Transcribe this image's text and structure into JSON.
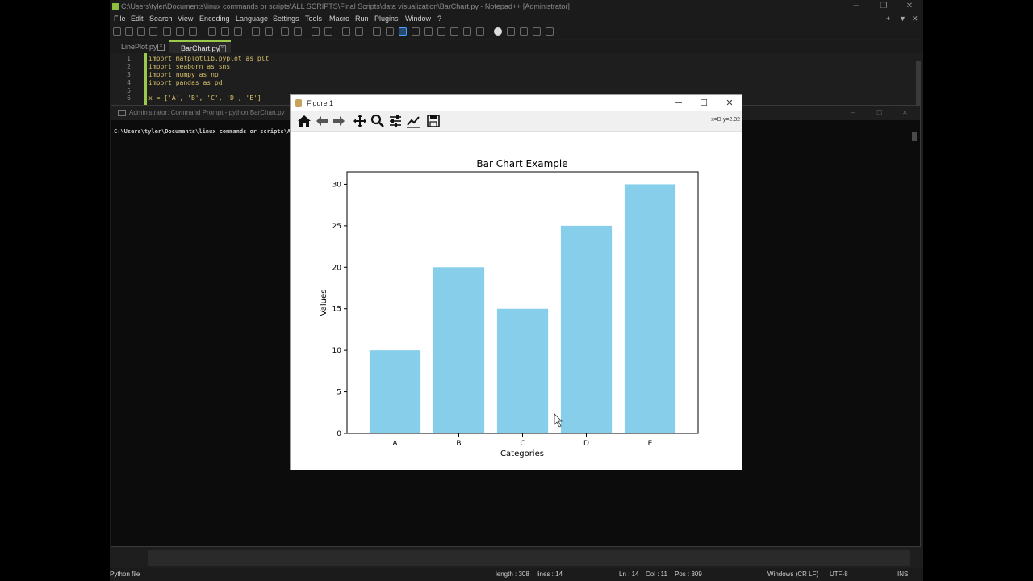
{
  "npp": {
    "title": "C:\\Users\\tyler\\Documents\\linux commands or scripts\\ALL SCRIPTS\\Final Scripts\\data visualization\\BarChart.py - Notepad++ [Administrator]",
    "menu": [
      "File",
      "Edit",
      "Search",
      "View",
      "Encoding",
      "Language",
      "Settings",
      "Tools",
      "Macro",
      "Run",
      "Plugins",
      "Window",
      "?"
    ],
    "tabs": [
      {
        "label": "LinePlot.py"
      },
      {
        "label": "BarChart.py"
      }
    ],
    "code": [
      {
        "n": "1",
        "kw": "import",
        "rest": " matplotlib.pyplot as plt"
      },
      {
        "n": "2",
        "kw": "import",
        "rest": " seaborn as sns"
      },
      {
        "n": "3",
        "kw": "import",
        "rest": " numpy as np"
      },
      {
        "n": "4",
        "kw": "import",
        "rest": " pandas as pd"
      },
      {
        "n": "5",
        "kw": "",
        "rest": ""
      },
      {
        "n": "6",
        "kw": "",
        "rest": "x = ['A', 'B', 'C', 'D', 'E']"
      }
    ],
    "status": {
      "lang": "Python file",
      "length": "length : 308",
      "lines": "lines : 14",
      "ln": "Ln : 14",
      "col": "Col : 11",
      "pos": "Pos : 309",
      "eol": "Windows (CR LF)",
      "enc": "UTF-8",
      "mode": "INS"
    }
  },
  "cmd": {
    "title": "Administrator: Command Prompt - python  BarChart.py",
    "line": "C:\\Users\\tyler\\Documents\\linux commands or scripts\\A"
  },
  "figure": {
    "title": "Figure 1",
    "coords": "x=D y=2.32"
  },
  "chart_data": {
    "type": "bar",
    "title": "Bar Chart Example",
    "xlabel": "Categories",
    "ylabel": "Values",
    "categories": [
      "A",
      "B",
      "C",
      "D",
      "E"
    ],
    "values": [
      10,
      20,
      15,
      25,
      30
    ],
    "ylim": [
      0,
      31.5
    ],
    "yticks": [
      0,
      5,
      10,
      15,
      20,
      25,
      30
    ],
    "color": "#87CEEB"
  }
}
